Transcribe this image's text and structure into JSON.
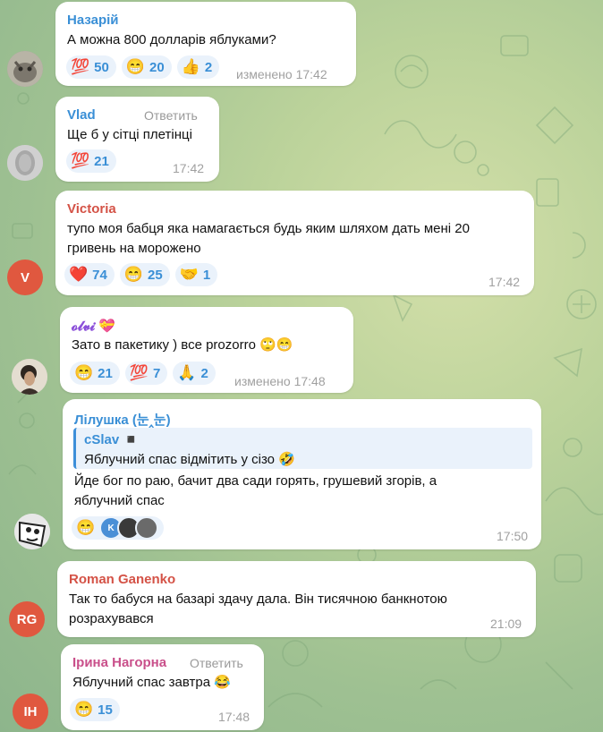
{
  "chat": {
    "messages": [
      {
        "sender": "Назарій",
        "sender_color": "#3a8fd6",
        "text": "А можна 800 долларів яблуками?",
        "time": "изменено 17:42",
        "reactions": [
          {
            "emoji": "💯",
            "count": "50"
          },
          {
            "emoji": "😁",
            "count": "20"
          },
          {
            "emoji": "👍",
            "count": "2"
          }
        ]
      },
      {
        "sender": "Vlad",
        "sender_color": "#3a8fd6",
        "reply_label": "Ответить",
        "text": "Ще б у сітці плетінці",
        "time": "17:42",
        "reactions": [
          {
            "emoji": "💯",
            "count": "21"
          }
        ]
      },
      {
        "sender": "Victoria",
        "sender_color": "#d45246",
        "avatar_initials": "V",
        "avatar_color": "#e0583f",
        "text_line1": "тупо моя бабця яка намагається будь яким шляхом дать мені 20",
        "text_line2": "гривень на морожено",
        "time": "17:42",
        "reactions": [
          {
            "emoji": "❤️",
            "count": "74"
          },
          {
            "emoji": "😁",
            "count": "25"
          },
          {
            "emoji": "🤝",
            "count": "1"
          }
        ]
      },
      {
        "sender": "𝓸𝓵𝓿𝓲 💝",
        "sender_color": "#8b4fd9",
        "text": "Зато в пакетику ) все prozorro 🙄😁",
        "time": "изменено 17:48",
        "reactions": [
          {
            "emoji": "😁",
            "count": "21"
          },
          {
            "emoji": "💯",
            "count": "7"
          },
          {
            "emoji": "🙏",
            "count": "2"
          }
        ]
      },
      {
        "sender": "Лілушка (눈‸눈)",
        "sender_color": "#3a8fd6",
        "quote_author": "cSlav ◾",
        "quote_text": "Яблучний спас відмітить у сізо 🤣",
        "text_line1": "Йде бог по раю, бачит два сади горять, грушевий згорів, а",
        "text_line2": "яблучний спас",
        "time": "17:50",
        "reaction_emoji": "😁",
        "reactor_initial": "K"
      },
      {
        "sender": "Roman Ganenko",
        "sender_color": "#d45246",
        "avatar_initials": "RG",
        "avatar_color": "#e0583f",
        "text_line1": "Так то бабуся на базарі здачу дала. Він тисячною банкнотою",
        "text_line2": "розрахувався",
        "time": "21:09"
      },
      {
        "sender": "Ірина Нагорна",
        "sender_color": "#c94f8a",
        "reply_label": "Ответить",
        "avatar_initials": "IH",
        "avatar_color": "#e0583f",
        "text": "Яблучний спас завтра 😂",
        "time": "17:48",
        "reactions": [
          {
            "emoji": "😁",
            "count": "15"
          }
        ]
      }
    ]
  }
}
